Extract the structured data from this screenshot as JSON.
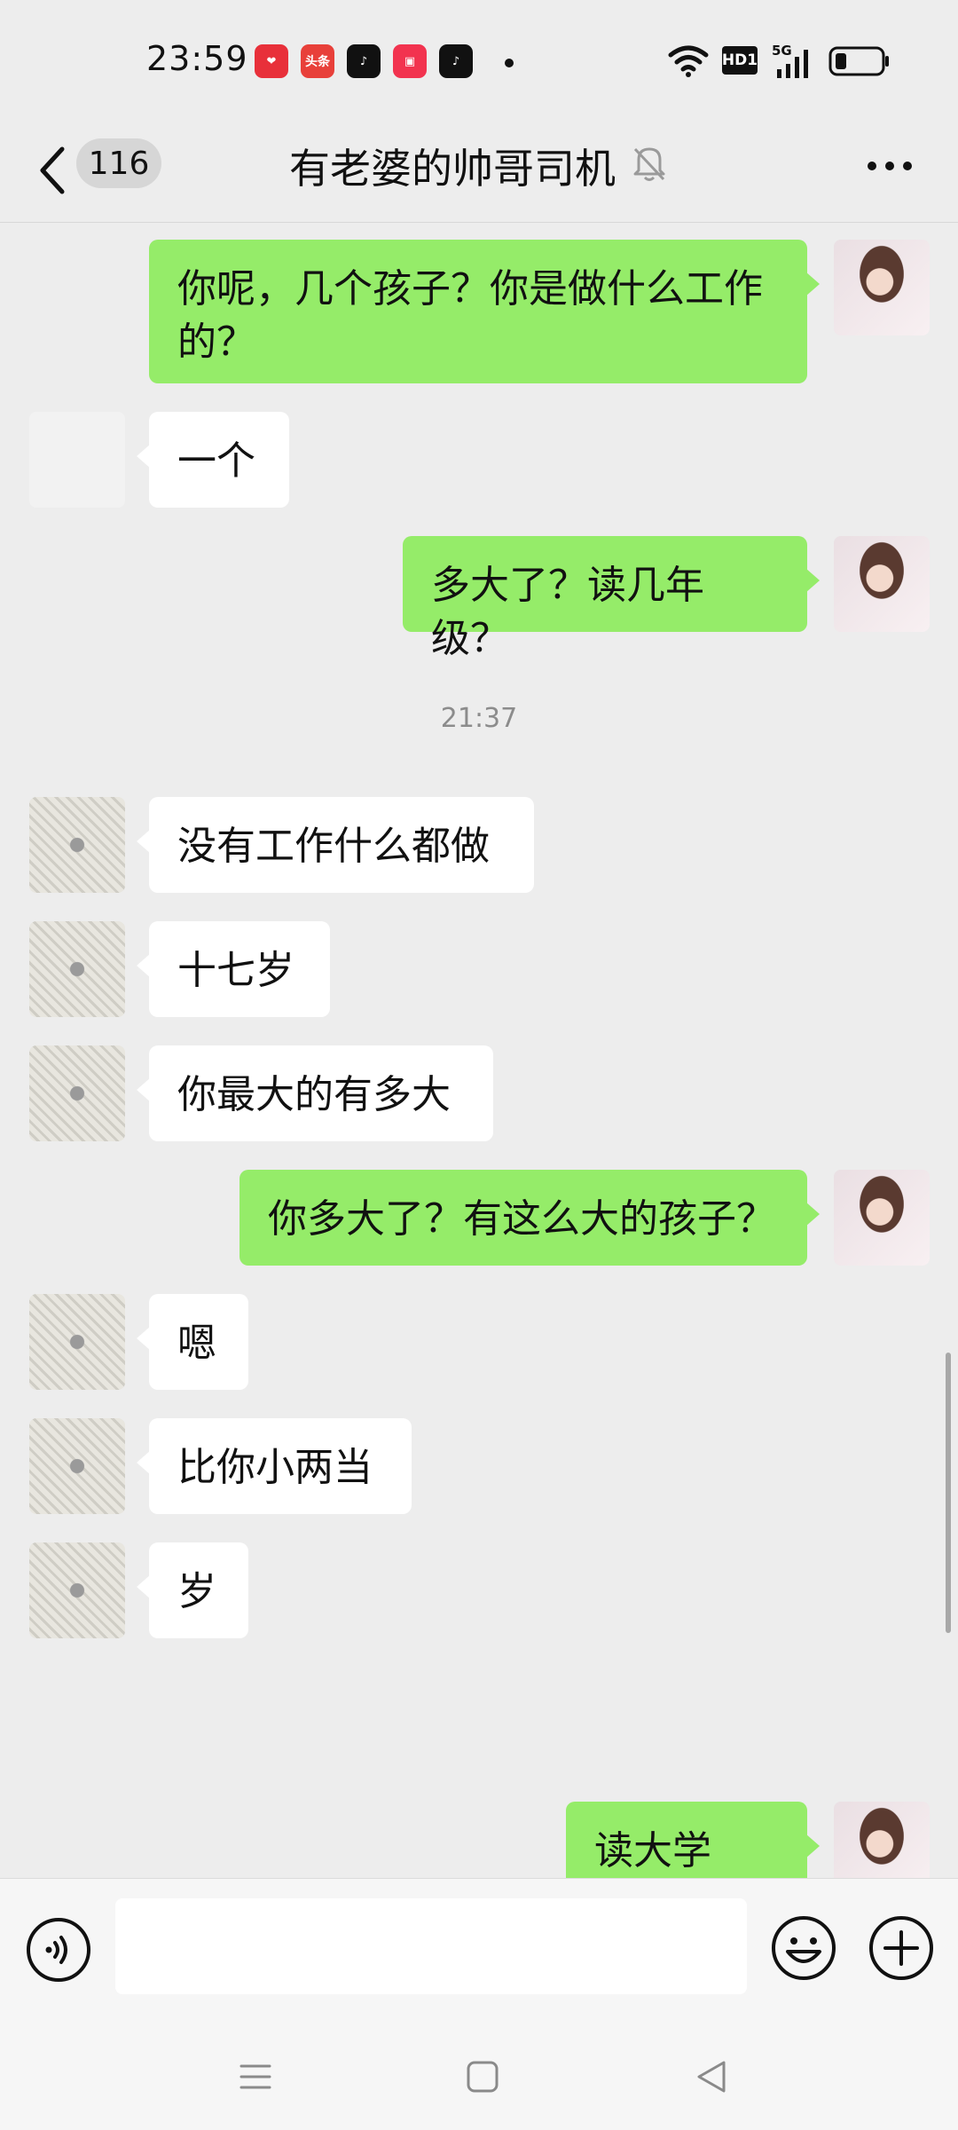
{
  "status_bar": {
    "time": "23:59",
    "apps": [
      {
        "icon": "heart-app-icon",
        "color": "#e8303a"
      },
      {
        "icon": "toutiao-icon",
        "label": "头条",
        "color": "#e8403a"
      },
      {
        "icon": "douyin-icon",
        "color": "#111111"
      },
      {
        "icon": "red-app-icon",
        "color": "#f2334f"
      },
      {
        "icon": "douyin-icon",
        "color": "#111111"
      }
    ],
    "network_label": "HD1",
    "cell_label": "5G"
  },
  "header": {
    "unread_count": "116",
    "title": "有老婆的帅哥司机",
    "muted": true
  },
  "timestamp": "21:37",
  "messages": [
    {
      "side": "me",
      "text_line1": "你呢，几个孩子？你是做什么工作",
      "text_line2": "的？"
    },
    {
      "side": "other",
      "text": "一个"
    },
    {
      "side": "me",
      "text": "多大了？读几年级？"
    },
    {
      "side": "other",
      "text": "没有工作什么都做"
    },
    {
      "side": "other",
      "text": "十七岁"
    },
    {
      "side": "other",
      "text": "你最大的有多大"
    },
    {
      "side": "me",
      "text": "你多大了？有这么大的孩子？"
    },
    {
      "side": "other",
      "text": "嗯"
    },
    {
      "side": "other",
      "text": "比你小两当"
    },
    {
      "side": "other",
      "text": "岁"
    },
    {
      "side": "me",
      "text": "读大学吗？"
    }
  ],
  "colors": {
    "background": "#ededed",
    "my_bubble": "#95ec69",
    "other_bubble": "#ffffff",
    "timestamp_text": "#8c8c8c"
  }
}
